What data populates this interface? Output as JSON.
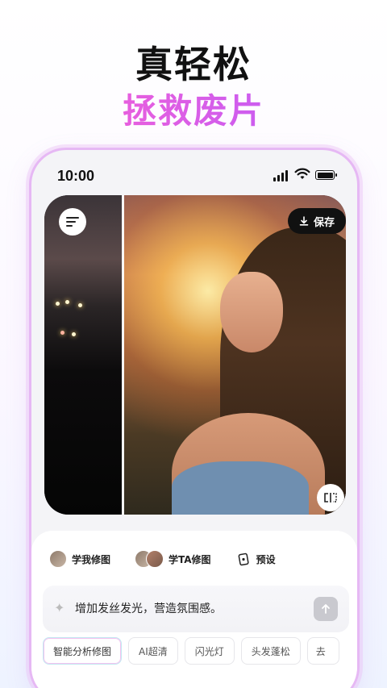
{
  "headline": {
    "title": "真轻松",
    "subtitle": "拯救废片"
  },
  "status_bar": {
    "time": "10:00"
  },
  "editor": {
    "save_label": "保存",
    "compare_label": "C|⃞"
  },
  "modes": [
    {
      "label": "学我修图"
    },
    {
      "label": "学TA修图"
    },
    {
      "label": "预设"
    }
  ],
  "prompt": {
    "text": "增加发丝发光，营造氛围感。"
  },
  "chips": [
    "智能分析修图",
    "AI超清",
    "闪光灯",
    "头发蓬松",
    "去"
  ],
  "colors": {
    "accent_pink": "#ff5fcf",
    "accent_purple": "#b45cff",
    "dark": "#111111"
  }
}
